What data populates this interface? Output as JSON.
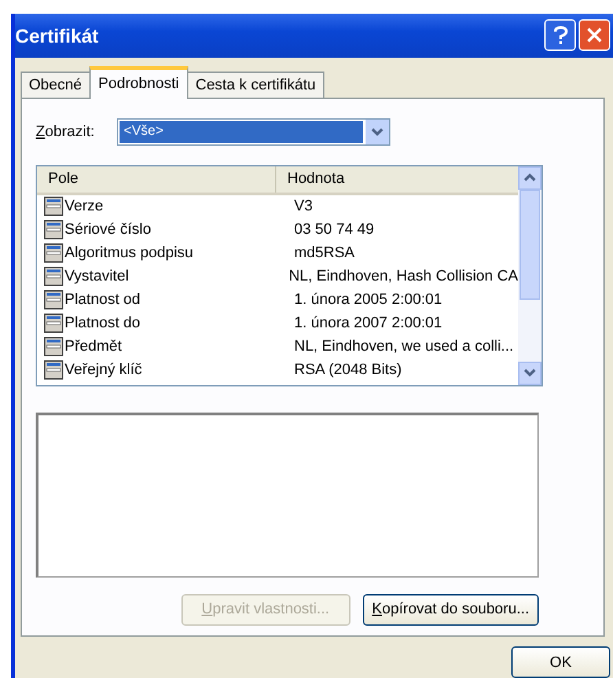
{
  "window": {
    "title": "Certifikát"
  },
  "tabs": [
    {
      "label": "Obecné",
      "selected": false
    },
    {
      "label": "Podrobnosti",
      "selected": true
    },
    {
      "label": "Cesta k certifikátu",
      "selected": false
    }
  ],
  "show": {
    "label": "Zobrazit:",
    "value": "<Vše>"
  },
  "table": {
    "columns": [
      "Pole",
      "Hodnota"
    ],
    "rows": [
      {
        "field": "Verze",
        "value": "V3"
      },
      {
        "field": "Sériové číslo",
        "value": "03 50 74 49"
      },
      {
        "field": "Algoritmus podpisu",
        "value": "md5RSA"
      },
      {
        "field": "Vystavitel",
        "value": "NL, Eindhoven, Hash Collision CA"
      },
      {
        "field": "Platnost od",
        "value": "1. února 2005 2:00:01"
      },
      {
        "field": "Platnost do",
        "value": "1. února 2007 2:00:01"
      },
      {
        "field": "Předmět",
        "value": "NL, Eindhoven, we used a colli..."
      },
      {
        "field": "Veřejný klíč",
        "value": "RSA (2048 Bits)"
      }
    ]
  },
  "buttons": [
    {
      "label": "Upravit vlastnosti...",
      "disabled": true
    },
    {
      "label": "Kopírovat do souboru...",
      "disabled": false
    }
  ],
  "footer_button": {
    "label": "OK"
  }
}
